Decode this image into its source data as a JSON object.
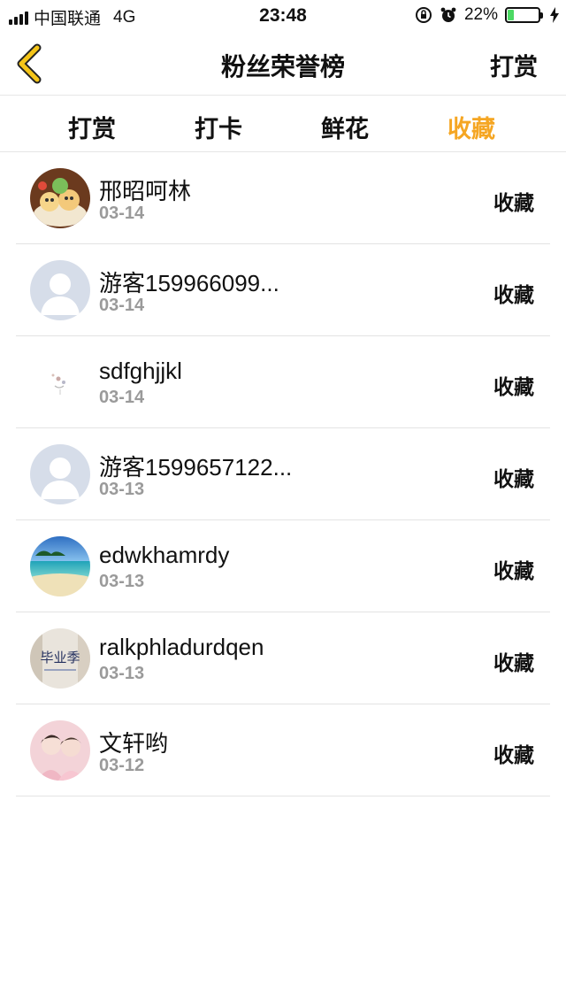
{
  "status_bar": {
    "carrier": "中国联通",
    "network": "4G",
    "time": "23:48",
    "battery_percent": "22%",
    "battery_level": 0.22,
    "icons": [
      "signal-icon",
      "orientation-lock-icon",
      "alarm-icon",
      "battery-icon",
      "charging-icon"
    ]
  },
  "header": {
    "title": "粉丝荣誉榜",
    "right_action": "打赏",
    "back_icon": "chevron-left-icon",
    "accent_color": "#f5c518"
  },
  "tabs": [
    {
      "label": "打赏",
      "active": false
    },
    {
      "label": "打卡",
      "active": false
    },
    {
      "label": "鲜花",
      "active": false
    },
    {
      "label": "收藏",
      "active": true
    }
  ],
  "active_tab_color": "#f5a623",
  "fans": [
    {
      "name": "邢昭呵林",
      "date": "03-14",
      "action": "收藏",
      "avatar": "food-photo-avatar"
    },
    {
      "name": "游客159966099...",
      "date": "03-14",
      "action": "收藏",
      "avatar": "default-user-avatar"
    },
    {
      "name": "sdfghjjkl",
      "date": "03-14",
      "action": "收藏",
      "avatar": "sketch-avatar"
    },
    {
      "name": "游客1599657122...",
      "date": "03-13",
      "action": "收藏",
      "avatar": "default-user-avatar"
    },
    {
      "name": "edwkhamrdy",
      "date": "03-13",
      "action": "收藏",
      "avatar": "beach-photo-avatar"
    },
    {
      "name": "ralkphladurdqen",
      "date": "03-13",
      "action": "收藏",
      "avatar": "graduation-photo-avatar",
      "avatar_text": "毕业季"
    },
    {
      "name": "文轩哟",
      "date": "03-12",
      "action": "收藏",
      "avatar": "portrait-photo-avatar"
    }
  ]
}
